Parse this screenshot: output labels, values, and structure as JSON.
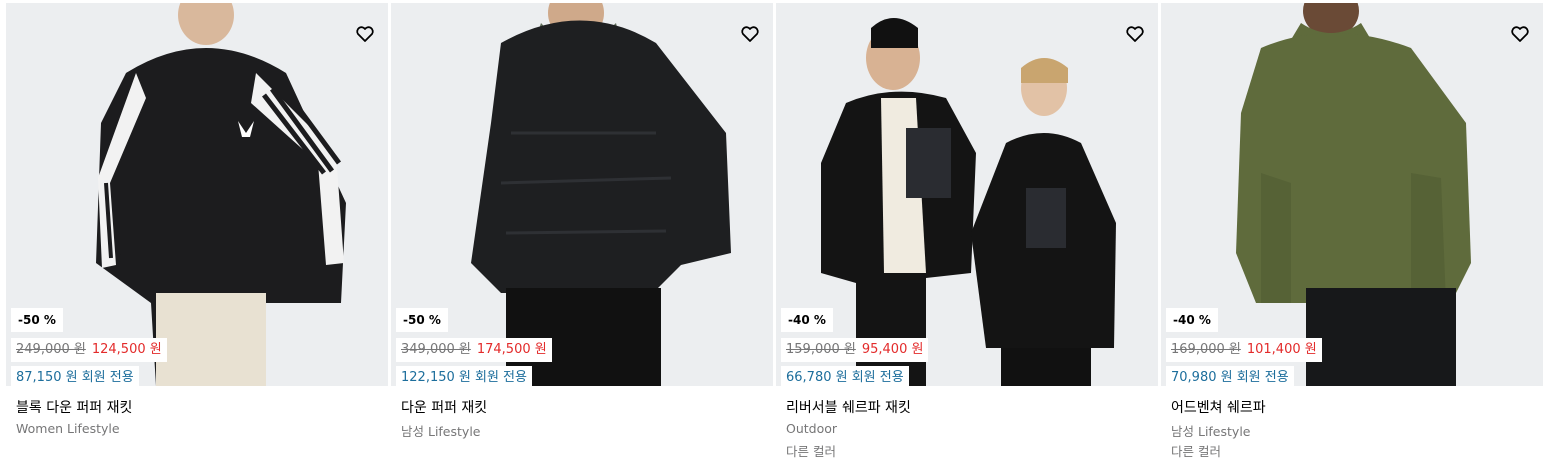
{
  "products": [
    {
      "discount": "-50 %",
      "original_price": "249,000 원",
      "sale_price": "124,500 원",
      "member_price": "87,150 원 회원 전용",
      "name": "블록 다운 퍼퍼 재킷",
      "category": "Women Lifestyle",
      "wishlist_icon": "heart-outline-icon"
    },
    {
      "discount": "-50 %",
      "original_price": "349,000 원",
      "sale_price": "174,500 원",
      "member_price": "122,150 원 회원 전용",
      "name": "다운 퍼퍼 재킷",
      "category": "남성 Lifestyle",
      "wishlist_icon": "heart-outline-icon"
    },
    {
      "discount": "-40 %",
      "original_price": "159,000 원",
      "sale_price": "95,400 원",
      "member_price": "66,780 원 회원 전용",
      "name": "리버서블 쉐르파 재킷",
      "category": "Outdoor",
      "extra": "다른 컬러",
      "wishlist_icon": "heart-outline-icon"
    },
    {
      "discount": "-40 %",
      "original_price": "169,000 원",
      "sale_price": "101,400 원",
      "member_price": "70,980 원 회원 전용",
      "name": "어드벤쳐 쉐르파",
      "category": "남성 Lifestyle",
      "extra": "다른 컬러",
      "wishlist_icon": "heart-outline-icon"
    }
  ],
  "colors": {
    "image_bg": "#eceef0",
    "sale": "#e32b2b",
    "member": "#1d6e9c",
    "muted": "#767677"
  }
}
